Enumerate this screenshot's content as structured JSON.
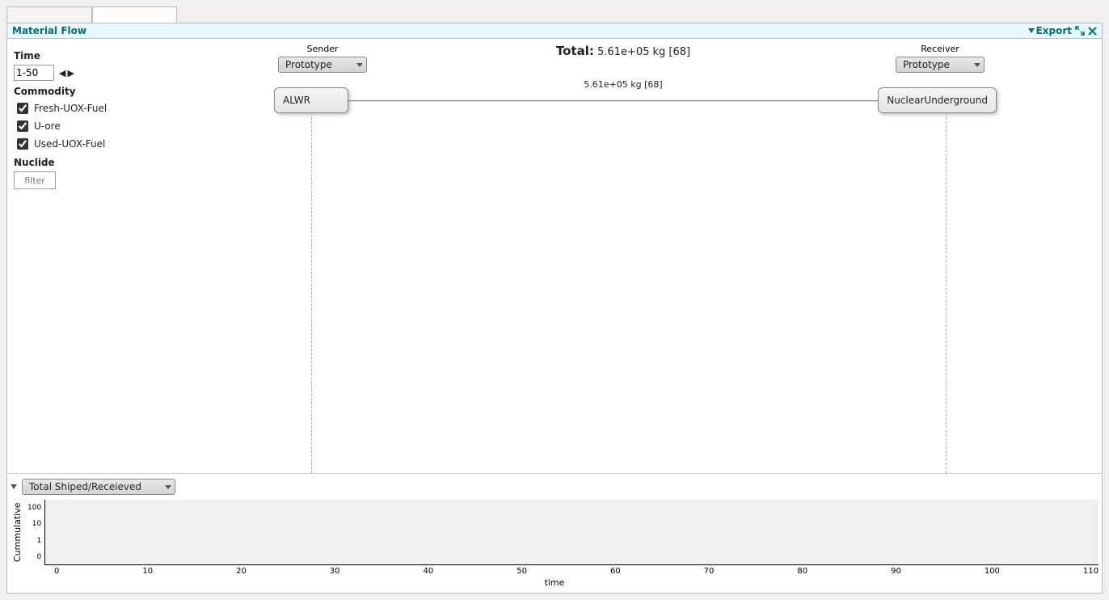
{
  "panel": {
    "title": "Material Flow",
    "export_label": "Export"
  },
  "sidebar": {
    "time_heading": "Time",
    "time_value": "1-50",
    "commodity_heading": "Commodity",
    "commodities": [
      {
        "label": "Fresh-UOX-Fuel",
        "checked": true
      },
      {
        "label": "U-ore",
        "checked": true
      },
      {
        "label": "Used-UOX-Fuel",
        "checked": true
      }
    ],
    "nuclide_heading": "Nuclide",
    "nuclide_placeholder": "filter"
  },
  "flow": {
    "sender_heading": "Sender",
    "receiver_heading": "Receiver",
    "sender_dropdown": "Prototype",
    "receiver_dropdown": "Prototype",
    "total_label": "Total:",
    "total_value": "5.61e+05 kg [68]",
    "sender_node": "ALWR",
    "receiver_node": "NuclearUnderground",
    "edge_label": "5.61e+05 kg [68]"
  },
  "lower": {
    "dropdown_label": "Total Shiped/Receieved"
  },
  "chart": {
    "ylabel": "Cummulative",
    "xlabel": "time"
  },
  "chart_data": {
    "type": "line",
    "title": "",
    "xlabel": "time",
    "ylabel": "Cummulative",
    "x_ticks": [
      0,
      10,
      20,
      30,
      40,
      50,
      60,
      70,
      80,
      90,
      100,
      110
    ],
    "y_ticks": [
      0,
      1,
      10,
      100
    ],
    "ylim": [
      0,
      100
    ],
    "xlim": [
      0,
      110
    ],
    "yscale": "log",
    "series": []
  }
}
